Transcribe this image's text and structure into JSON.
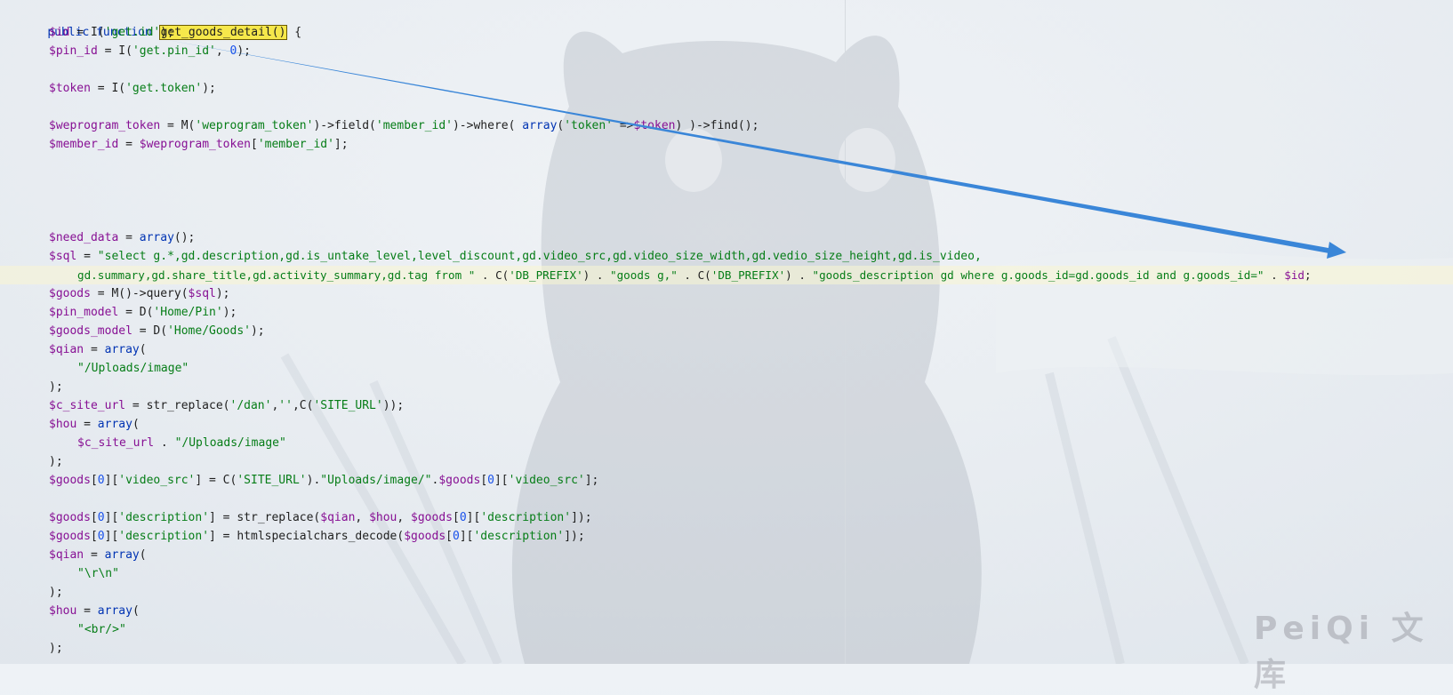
{
  "code": {
    "line_1": {
      "kw_public": "public",
      "kw_function": "function",
      "fn_name": "get_goods_detail()",
      "brace": "{"
    },
    "line_2": {
      "var": "$id",
      "op": " = I(",
      "str": "'get.id'",
      "end": ");"
    },
    "line_3": {
      "var": "$pin_id",
      "op": " = I(",
      "str": "'get.pin_id'",
      "comma": ", ",
      "num": "0",
      "end": ");"
    },
    "line_4": {
      "var": "$token",
      "op": " = I(",
      "str": "'get.token'",
      "end": ");"
    },
    "line_5": {
      "var": "$weprogram_token",
      "op1": " = M(",
      "str1": "'weprogram_token'",
      "op2": ")->field(",
      "str2": "'member_id'",
      "op3": ")->where( ",
      "kw": "array",
      "op4": "(",
      "str3": "'token'",
      "op5": " =>",
      "var2": "$token",
      "end": ") )->find();"
    },
    "line_6": {
      "var": "$member_id",
      "op": " = ",
      "var2": "$weprogram_token",
      "op2": "[",
      "str": "'member_id'",
      "end": "];"
    },
    "line_7": {
      "var": "$need_data",
      "op": " = ",
      "kw": "array",
      "end": "();"
    },
    "line_8": {
      "var": "$sql",
      "op": " = ",
      "str": "\"select g.*,gd.description,gd.is_untake_level,level_discount,gd.video_src,gd.video_size_width,gd.vedio_size_height,gd.is_video,"
    },
    "line_9": {
      "str1": "gd.summary,gd.share_title,gd.activity_summary,gd.tag from \"",
      "op1": " . C(",
      "str2": "'DB_PREFIX'",
      "op2": ") . ",
      "str3": "\"goods g,\"",
      "op3": " . C(",
      "str4": "'DB_PREFIX'",
      "op4": ") . ",
      "str5": "\"goods_description gd where g.goods_id=gd.goods_id and g.goods_id=\"",
      "op5": " . ",
      "var": "$id",
      "end": ";"
    },
    "line_10": {
      "var": "$goods",
      "op": " = M()->query(",
      "var2": "$sql",
      "end": ");"
    },
    "line_11": {
      "var": "$pin_model",
      "op": " = D(",
      "str": "'Home/Pin'",
      "end": ");"
    },
    "line_12": {
      "var": "$goods_model",
      "op": " = D(",
      "str": "'Home/Goods'",
      "end": ");"
    },
    "line_13": {
      "var": "$qian",
      "op": " = ",
      "kw": "array",
      "end": "("
    },
    "line_14": {
      "str": "\"/Uploads/image\""
    },
    "line_15": {
      "end": ");"
    },
    "line_16": {
      "var": "$c_site_url",
      "op": " = str_replace(",
      "str1": "'/dan'",
      "c1": ",",
      "str2": "''",
      "op2": ",C(",
      "str3": "'SITE_URL'",
      "end": "));"
    },
    "line_17": {
      "var": "$hou",
      "op": " = ",
      "kw": "array",
      "end": "("
    },
    "line_18": {
      "var": "$c_site_url",
      "op": " . ",
      "str": "\"/Uploads/image\""
    },
    "line_19": {
      "end": ");"
    },
    "line_20": {
      "var": "$goods",
      "b1": "[",
      "num": "0",
      "b2": "][",
      "str": "'video_src'",
      "op": "] = C(",
      "str2": "'SITE_URL'",
      "op2": ").",
      "str3": "\"Uploads/image/\"",
      "op3": ".",
      "var2": "$goods",
      "b3": "[",
      "num2": "0",
      "b4": "][",
      "str4": "'video_src'",
      "end": "];"
    },
    "line_21": {
      "var": "$goods",
      "b1": "[",
      "num": "0",
      "b2": "][",
      "str": "'description'",
      "op": "] = str_replace(",
      "var2": "$qian",
      "c1": ", ",
      "var3": "$hou",
      "c2": ", ",
      "var4": "$goods",
      "b3": "[",
      "num2": "0",
      "b4": "][",
      "str2": "'description'",
      "end": "]);"
    },
    "line_22": {
      "var": "$goods",
      "b1": "[",
      "num": "0",
      "b2": "][",
      "str": "'description'",
      "op": "] = htmlspecialchars_decode(",
      "var2": "$goods",
      "b3": "[",
      "num2": "0",
      "b4": "][",
      "str2": "'description'",
      "end": "]);"
    },
    "line_23": {
      "var": "$qian",
      "op": " = ",
      "kw": "array",
      "end": "("
    },
    "line_24": {
      "str": "\"\\r\\n\""
    },
    "line_25": {
      "end": ");"
    },
    "line_26": {
      "var": "$hou",
      "op": " = ",
      "kw": "array",
      "end": "("
    },
    "line_27": {
      "str": "\"<br/>\""
    },
    "line_28": {
      "end": ");"
    }
  },
  "watermark": "PeiQi 文库",
  "colors": {
    "keyword": "#0033b3",
    "variable": "#871094",
    "string": "#067d17",
    "number": "#1750eb",
    "highlight": "#f6e84b",
    "arrow": "#3a86d8"
  }
}
